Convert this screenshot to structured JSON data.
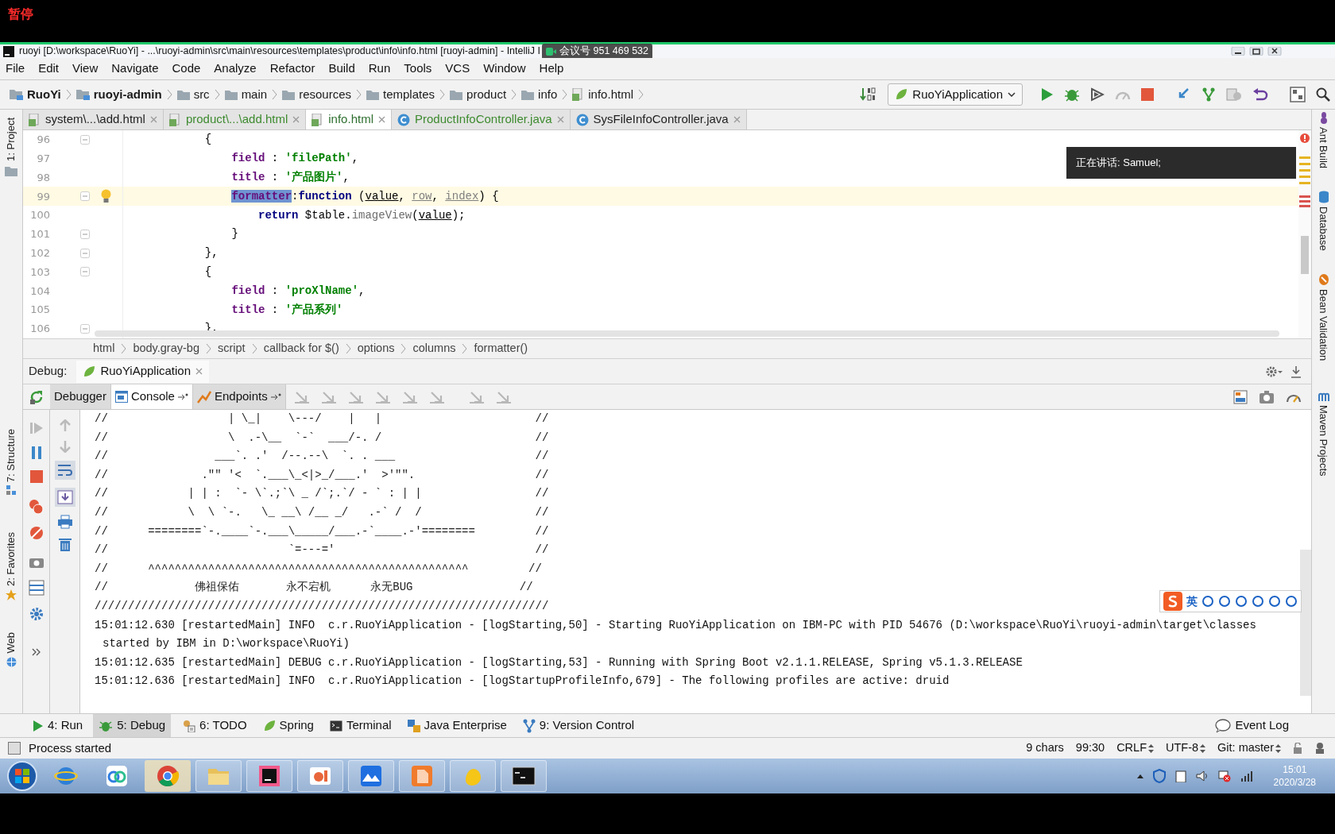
{
  "recorder": {
    "status": "暂停"
  },
  "window": {
    "title": "ruoyi [D:\\workspace\\RuoYi] - ...\\ruoyi-admin\\src\\main\\resources\\templates\\product\\info\\info.html [ruoyi-admin] - IntelliJ I"
  },
  "meeting_badge": "会议号 951 469 532",
  "menu": [
    "File",
    "Edit",
    "View",
    "Navigate",
    "Code",
    "Analyze",
    "Refactor",
    "Build",
    "Run",
    "Tools",
    "VCS",
    "Window",
    "Help"
  ],
  "nav_path": [
    {
      "label": "RuoYi",
      "kind": "module"
    },
    {
      "label": "ruoyi-admin",
      "kind": "module"
    },
    {
      "label": "src",
      "kind": "folder"
    },
    {
      "label": "main",
      "kind": "folder"
    },
    {
      "label": "resources",
      "kind": "folder"
    },
    {
      "label": "templates",
      "kind": "folder"
    },
    {
      "label": "product",
      "kind": "folder"
    },
    {
      "label": "info",
      "kind": "folder"
    },
    {
      "label": "info.html",
      "kind": "file"
    }
  ],
  "run_config": "RuoYiApplication",
  "left_panels": [
    "1: Project",
    "7: Structure",
    "2: Favorites",
    "Web"
  ],
  "right_panels": [
    "Ant Build",
    "Database",
    "Bean Validation",
    "Maven Projects"
  ],
  "editor_tabs": [
    {
      "label": "system\\...\\add.html",
      "kind": "html",
      "selected": false,
      "color": "#1e1e1e"
    },
    {
      "label": "product\\...\\add.html",
      "kind": "html",
      "selected": false,
      "color": "#3d8b2f"
    },
    {
      "label": "info.html",
      "kind": "html",
      "selected": true,
      "color": "#2f6f2f"
    },
    {
      "label": "ProductInfoController.java",
      "kind": "class",
      "selected": false,
      "color": "#3d8b2f"
    },
    {
      "label": "SysFileInfoController.java",
      "kind": "class",
      "selected": false,
      "color": "#1e1e1e"
    }
  ],
  "editor": {
    "lines": [
      {
        "number": "96",
        "fold": true,
        "tokens": [
          {
            "text": "            {",
            "kind": "plain"
          }
        ]
      },
      {
        "number": "97",
        "tokens": [
          {
            "text": "                field",
            "kind": "key"
          },
          {
            "text": " : ",
            "kind": "plain"
          },
          {
            "text": "'filePath'",
            "kind": "str"
          },
          {
            "text": ",",
            "kind": "plain"
          }
        ]
      },
      {
        "number": "98",
        "tokens": [
          {
            "text": "                title",
            "kind": "key"
          },
          {
            "text": " : ",
            "kind": "plain"
          },
          {
            "text": "'产品图片'",
            "kind": "str"
          },
          {
            "text": ",",
            "kind": "plain"
          }
        ]
      },
      {
        "number": "99",
        "fold": true,
        "current": true,
        "bulb": true,
        "tokens": [
          {
            "text": "                formatter",
            "kind": "key",
            "selected": true
          },
          {
            "text": ":",
            "kind": "plain"
          },
          {
            "text": "function",
            "kind": "kw"
          },
          {
            "text": " (",
            "kind": "plain"
          },
          {
            "text": "value",
            "kind": "param"
          },
          {
            "text": ", ",
            "kind": "plain"
          },
          {
            "text": "row",
            "kind": "unused"
          },
          {
            "text": ", ",
            "kind": "plain"
          },
          {
            "text": "index",
            "kind": "unused"
          },
          {
            "text": ") {",
            "kind": "plain"
          }
        ]
      },
      {
        "number": "100",
        "tokens": [
          {
            "text": "                    return",
            "kind": "kw"
          },
          {
            "text": " $table.",
            "kind": "plain"
          },
          {
            "text": "imageView",
            "kind": "method"
          },
          {
            "text": "(",
            "kind": "plain"
          },
          {
            "text": "value",
            "kind": "param"
          },
          {
            "text": ");",
            "kind": "plain"
          }
        ]
      },
      {
        "number": "101",
        "fold": true,
        "tokens": [
          {
            "text": "                }",
            "kind": "plain"
          }
        ]
      },
      {
        "number": "102",
        "fold": true,
        "tokens": [
          {
            "text": "            },",
            "kind": "plain"
          }
        ]
      },
      {
        "number": "103",
        "fold": true,
        "tokens": [
          {
            "text": "            {",
            "kind": "plain"
          }
        ]
      },
      {
        "number": "104",
        "tokens": [
          {
            "text": "                field",
            "kind": "key"
          },
          {
            "text": " : ",
            "kind": "plain"
          },
          {
            "text": "'proXlName'",
            "kind": "str"
          },
          {
            "text": ",",
            "kind": "plain"
          }
        ]
      },
      {
        "number": "105",
        "tokens": [
          {
            "text": "                title",
            "kind": "key"
          },
          {
            "text": " : ",
            "kind": "plain"
          },
          {
            "text": "'产品系列'",
            "kind": "str"
          }
        ]
      },
      {
        "number": "106",
        "fold": true,
        "tokens": [
          {
            "text": "            },",
            "kind": "plain"
          }
        ]
      }
    ]
  },
  "editor_breadcrumb": [
    "html",
    "body.gray-bg",
    "script",
    "callback for $()",
    "options",
    "columns",
    "formatter()"
  ],
  "speaking_popup": "正在讲话: Samuel;",
  "debug": {
    "label": "Debug:",
    "session": "RuoYiApplication",
    "tabs": [
      {
        "label": "Debugger",
        "kind": "plain",
        "selected": false
      },
      {
        "label": "Console",
        "kind": "pinnable",
        "selected": true
      },
      {
        "label": "Endpoints",
        "kind": "pinnable",
        "selected": false
      }
    ],
    "console": [
      {
        "text": "//                  | \\_|    \\---/    |   |                       //",
        "kind": "art"
      },
      {
        "text": "//                  \\  .-\\__  `-`  ___/-. /                       //",
        "kind": "art"
      },
      {
        "text": "//                ___`. .'  /--.--\\  `. . ___                     //",
        "kind": "art"
      },
      {
        "text": "//              .\"\" '<  `.___\\_<|>_/___.'  >'\"\".                  //",
        "kind": "art"
      },
      {
        "text": "//            | | :  `- \\`.;`\\ _ /`;.`/ - ` : | |                 //",
        "kind": "art"
      },
      {
        "text": "//            \\  \\ `-.   \\_ __\\ /__ _/   .-` /  /                 //",
        "kind": "art"
      },
      {
        "text": "//      ========`-.____`-.___\\_____/___.-`____.-'========         //",
        "kind": "art"
      },
      {
        "text": "//                           `=---='                              //",
        "kind": "art"
      },
      {
        "text": "//      ^^^^^^^^^^^^^^^^^^^^^^^^^^^^^^^^^^^^^^^^^^^^^^^^         //",
        "kind": "art"
      },
      {
        "text": "//             佛祖保佑       永不宕机      永无BUG                //",
        "kind": "art"
      },
      {
        "text": "////////////////////////////////////////////////////////////////////",
        "kind": "art"
      },
      {
        "text": "15:01:12.630 [restartedMain] INFO  c.r.RuoYiApplication - [logStarting,50] - Starting RuoYiApplication on IBM-PC with PID 54676 (D:\\workspace\\RuoYi\\ruoyi-admin\\target\\classes",
        "kind": "log"
      },
      {
        "text": "started by IBM in D:\\workspace\\RuoYi)",
        "kind": "continuation"
      },
      {
        "text": "15:01:12.635 [restartedMain] DEBUG c.r.RuoYiApplication - [logStarting,53] - Running with Spring Boot v2.1.1.RELEASE, Spring v5.1.3.RELEASE",
        "kind": "log"
      },
      {
        "text": "15:01:12.636 [restartedMain] INFO  c.r.RuoYiApplication - [logStartupProfileInfo,679] - The following profiles are active: druid",
        "kind": "log"
      }
    ]
  },
  "ime_bar": {
    "mode": "英"
  },
  "tool_tabs": [
    {
      "label": "4: Run",
      "kind": "run",
      "selected": false
    },
    {
      "label": "5: Debug",
      "kind": "debug",
      "selected": true
    },
    {
      "label": "6: TODO",
      "kind": "todo",
      "selected": false
    },
    {
      "label": "Spring",
      "kind": "spring",
      "selected": false
    },
    {
      "label": "Terminal",
      "kind": "terminal",
      "selected": false
    },
    {
      "label": "Java Enterprise",
      "kind": "javaee",
      "selected": false
    },
    {
      "label": "9: Version Control",
      "kind": "vcs",
      "selected": false
    }
  ],
  "event_log": "Event Log",
  "status_bar": {
    "message": "Process started",
    "selection": "9 chars",
    "position": "99:30",
    "line_separator": "CRLF",
    "encoding": "UTF-8",
    "vcs_branch": "Git: master"
  },
  "clock": {
    "time": "15:01",
    "date": "2020/3/28"
  }
}
